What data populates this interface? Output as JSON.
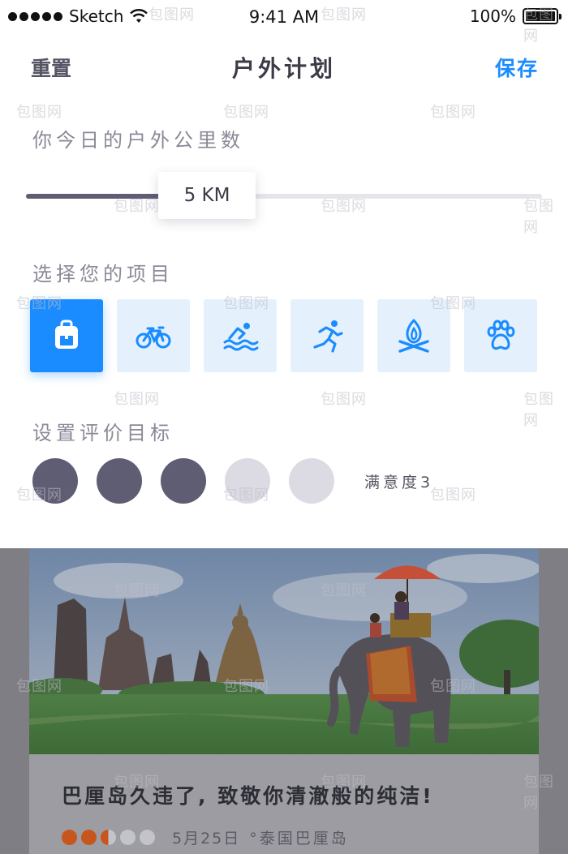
{
  "status_bar": {
    "carrier": "Sketch",
    "time": "9:41 AM",
    "battery_percent": "100%"
  },
  "navbar": {
    "reset_label": "重置",
    "title": "户外计划",
    "save_label": "保存"
  },
  "distance": {
    "label": "你今日的户外公里数",
    "value_text": "5 KM",
    "slider_fraction": 0.35
  },
  "activities": {
    "label": "选择您的项目",
    "items": [
      {
        "icon": "backpack-icon",
        "selected": true
      },
      {
        "icon": "bicycle-icon",
        "selected": false
      },
      {
        "icon": "swimming-icon",
        "selected": false
      },
      {
        "icon": "running-icon",
        "selected": false
      },
      {
        "icon": "campfire-icon",
        "selected": false
      },
      {
        "icon": "paw-icon",
        "selected": false
      }
    ]
  },
  "rating": {
    "label": "设置评价目标",
    "value": 3,
    "max": 5,
    "text": "满意度3"
  },
  "card": {
    "title": "巴厘岛久违了, 致敬你清澈般的纯洁!",
    "date": "5月25日",
    "location": "°泰国巴厘岛",
    "rating_value": 2.5,
    "rating_max": 5
  },
  "watermark": "包图网",
  "colors": {
    "accent": "#1a8cff",
    "accent_light": "#e4f1fd",
    "dark_dot": "#5f5d73",
    "light_dot": "#dcdbe4"
  }
}
